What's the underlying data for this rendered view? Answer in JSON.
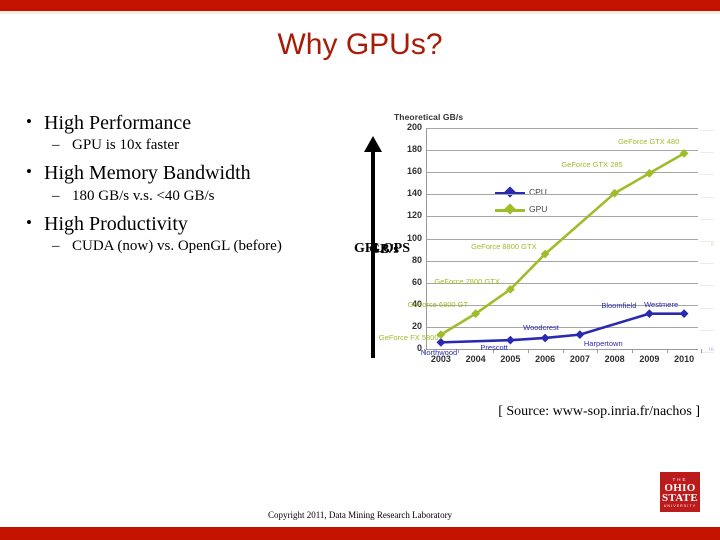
{
  "slide": {
    "title": "Why GPUs?",
    "accent_color": "#c41200",
    "title_color": "#a81b06",
    "source_note": "[ Source: www-sop.inria.fr/nachos ]",
    "footer": "Copyright 2011, Data Mining Research Laboratory"
  },
  "bullets": [
    {
      "level": 1,
      "marker": "•",
      "text": "High Performance"
    },
    {
      "level": 2,
      "marker": "–",
      "text": "GPU is 10x faster"
    },
    {
      "level": 1,
      "marker": "•",
      "text": "High Memory Bandwidth"
    },
    {
      "level": 2,
      "marker": "–",
      "text": "180 GB/s v.s. <40 GB/s"
    },
    {
      "level": 1,
      "marker": "•",
      "text": "High Productivity"
    },
    {
      "level": 2,
      "marker": "–",
      "text": "CUDA (now) vs. OpenGL (before)"
    }
  ],
  "axis_captions": {
    "caption_a": "GFLOPS",
    "caption_b": "GB/s"
  },
  "logo": {
    "line1": "THE",
    "line2": "OHIO",
    "line3": "STATE",
    "line4": "UNIVERSITY",
    "color": "#bb1b1b"
  },
  "chart_data": {
    "type": "line",
    "title": "Theoretical GB/s",
    "xlabel": "",
    "ylabel": "",
    "grid": true,
    "legend_position": "inside-top-left",
    "x": [
      2003,
      2004,
      2005,
      2006,
      2007,
      2008,
      2009,
      2010
    ],
    "xticks": [
      "2003",
      "2004",
      "2005",
      "2006",
      "2007",
      "2008",
      "2009",
      "2010"
    ],
    "yticks": [
      "0",
      "20",
      "40",
      "60",
      "80",
      "100",
      "120",
      "140",
      "160",
      "180",
      "200"
    ],
    "ylim": [
      0,
      200
    ],
    "xlim": [
      2002.6,
      2010.4
    ],
    "series": [
      {
        "name": "CPU",
        "color": "#2a2ab0",
        "x": [
          2003,
          2005,
          2006,
          2007,
          2009,
          2010
        ],
        "values": [
          6,
          8,
          10,
          13,
          32,
          32
        ],
        "point_labels": [
          "Northwood",
          "Prescott",
          "Woodcrest",
          "Harpertown",
          "Bloomfield",
          "Westmere"
        ]
      },
      {
        "name": "GPU",
        "color": "#9fbd2a",
        "x": [
          2003,
          2004,
          2005,
          2006,
          2008,
          2009,
          2010
        ],
        "values": [
          13,
          32,
          54,
          86,
          141,
          159,
          177
        ],
        "point_labels": [
          "GeForce FX 5800",
          "GeForce 6800 GT",
          "GeForce 7800 GTX",
          "GeForce 8800 GTX",
          "",
          "GeForce GTX 285",
          "GeForce GTX 480"
        ]
      }
    ],
    "annotations": [
      {
        "text": "GeForce GTX 480",
        "series": "GPU",
        "x": 2010,
        "y": 177
      },
      {
        "text": "GeForce GTX 285",
        "series": "GPU",
        "x": 2009,
        "y": 159
      },
      {
        "text": "GeForce 8800 GTX",
        "series": "GPU",
        "x": 2006,
        "y": 86
      },
      {
        "text": "GeForce 7800 GTX",
        "series": "GPU",
        "x": 2005,
        "y": 54
      },
      {
        "text": "GeForce 6800 GT",
        "series": "GPU",
        "x": 2004,
        "y": 32
      },
      {
        "text": "GeForce FX 5800",
        "series": "GPU",
        "x": 2003,
        "y": 13
      },
      {
        "text": "Westmere",
        "series": "CPU",
        "x": 2010,
        "y": 32
      },
      {
        "text": "Bloomfield",
        "series": "CPU",
        "x": 2009,
        "y": 32
      },
      {
        "text": "Harpertown",
        "series": "CPU",
        "x": 2007,
        "y": 13
      },
      {
        "text": "Woodcrest",
        "series": "CPU",
        "x": 2006,
        "y": 10
      },
      {
        "text": "Prescott",
        "series": "CPU",
        "x": 2005,
        "y": 8
      },
      {
        "text": "Northwood",
        "series": "CPU",
        "x": 2003,
        "y": 6
      }
    ]
  }
}
